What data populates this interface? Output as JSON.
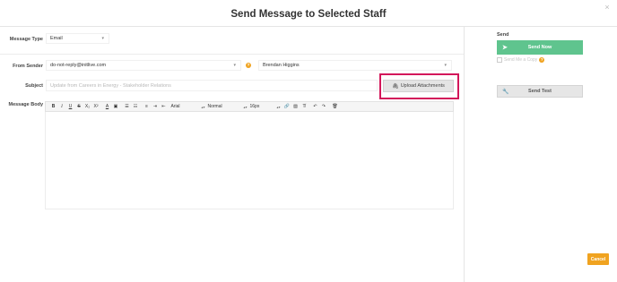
{
  "dialog": {
    "title": "Send Message to Selected Staff",
    "close_glyph": "×"
  },
  "form": {
    "message_type": {
      "label": "Message Type",
      "value": "Email"
    },
    "from_sender": {
      "label": "From Sender",
      "email": "do-not-reply@initlive.com",
      "name": "Brendan Higgins"
    },
    "subject": {
      "label": "Subject",
      "placeholder": "Update from Careers in Energy - Stakeholder Relations"
    },
    "upload": {
      "label": "Upload Attachments",
      "icon": "paperclip-icon"
    },
    "message_body": {
      "label": "Message Body"
    }
  },
  "toolbar": {
    "buttons": [
      "B",
      "I",
      "U",
      "S",
      "X₂",
      "X²",
      "A",
      "▣",
      "☰",
      "☷",
      "≡",
      "⇥",
      "⇤",
      "↶",
      "↷",
      "🗑"
    ],
    "font_family": "Arial",
    "block_format": "Normal",
    "font_size": "16px"
  },
  "send_panel": {
    "heading": "Send",
    "send_now": "Send Now",
    "send_copy": "Send Me a Copy",
    "send_test": "Send Test"
  },
  "footer": {
    "cancel": "Cancel"
  },
  "colors": {
    "accent_green": "#5fc48e",
    "accent_orange": "#f0a320",
    "highlight_pink": "#d3175a"
  }
}
